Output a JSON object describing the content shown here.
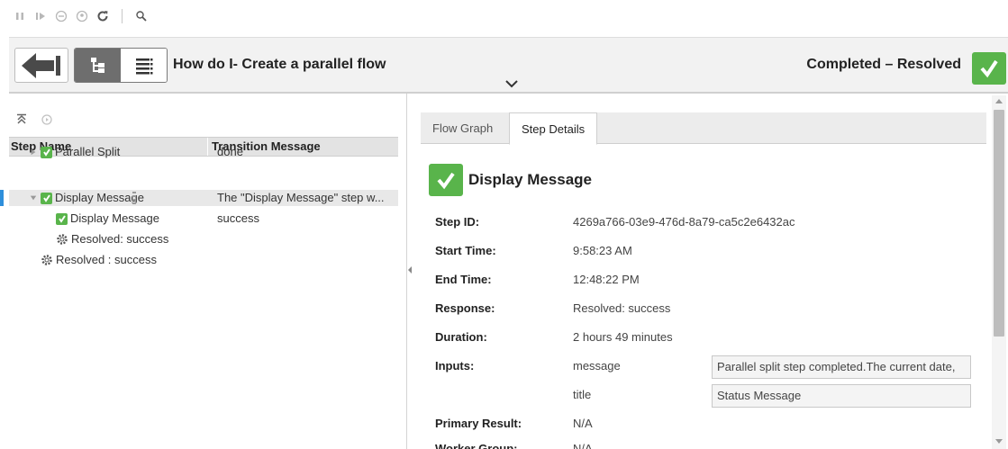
{
  "header": {
    "title": "How do I- Create a parallel flow",
    "status": "Completed – Resolved"
  },
  "tree": {
    "columns": [
      "Step Name",
      "Transition Message"
    ],
    "rows": [
      {
        "name": "Parallel Split",
        "message": "done"
      },
      {
        "name": "Display Message",
        "message": "The \"Display Message\" step w..."
      },
      {
        "name": "Display Message",
        "message": "success"
      },
      {
        "name": "Resolved: success",
        "message": ""
      },
      {
        "name": "Resolved : success",
        "message": ""
      }
    ]
  },
  "tabs": [
    "Flow Graph",
    "Step Details"
  ],
  "details": {
    "title": "Display Message",
    "step_id_label": "Step ID:",
    "step_id": "4269a766-03e9-476d-8a79-ca5c2e6432ac",
    "start_label": "Start Time:",
    "start": "9:58:23 AM",
    "end_label": "End Time:",
    "end": "12:48:22 PM",
    "response_label": "Response:",
    "response": "Resolved: success",
    "duration_label": "Duration:",
    "duration": "2 hours 49 minutes",
    "inputs_label": "Inputs:",
    "inputs": [
      {
        "name": "message",
        "value": "Parallel split step completed.The current date,"
      },
      {
        "name": "title",
        "value": "Status Message"
      }
    ],
    "primary_label": "Primary Result:",
    "primary": "N/A",
    "worker_label": "Worker Group:",
    "worker": "N/A"
  },
  "colors": {
    "success": "#59b44b",
    "selection": "#2e8fdb"
  }
}
